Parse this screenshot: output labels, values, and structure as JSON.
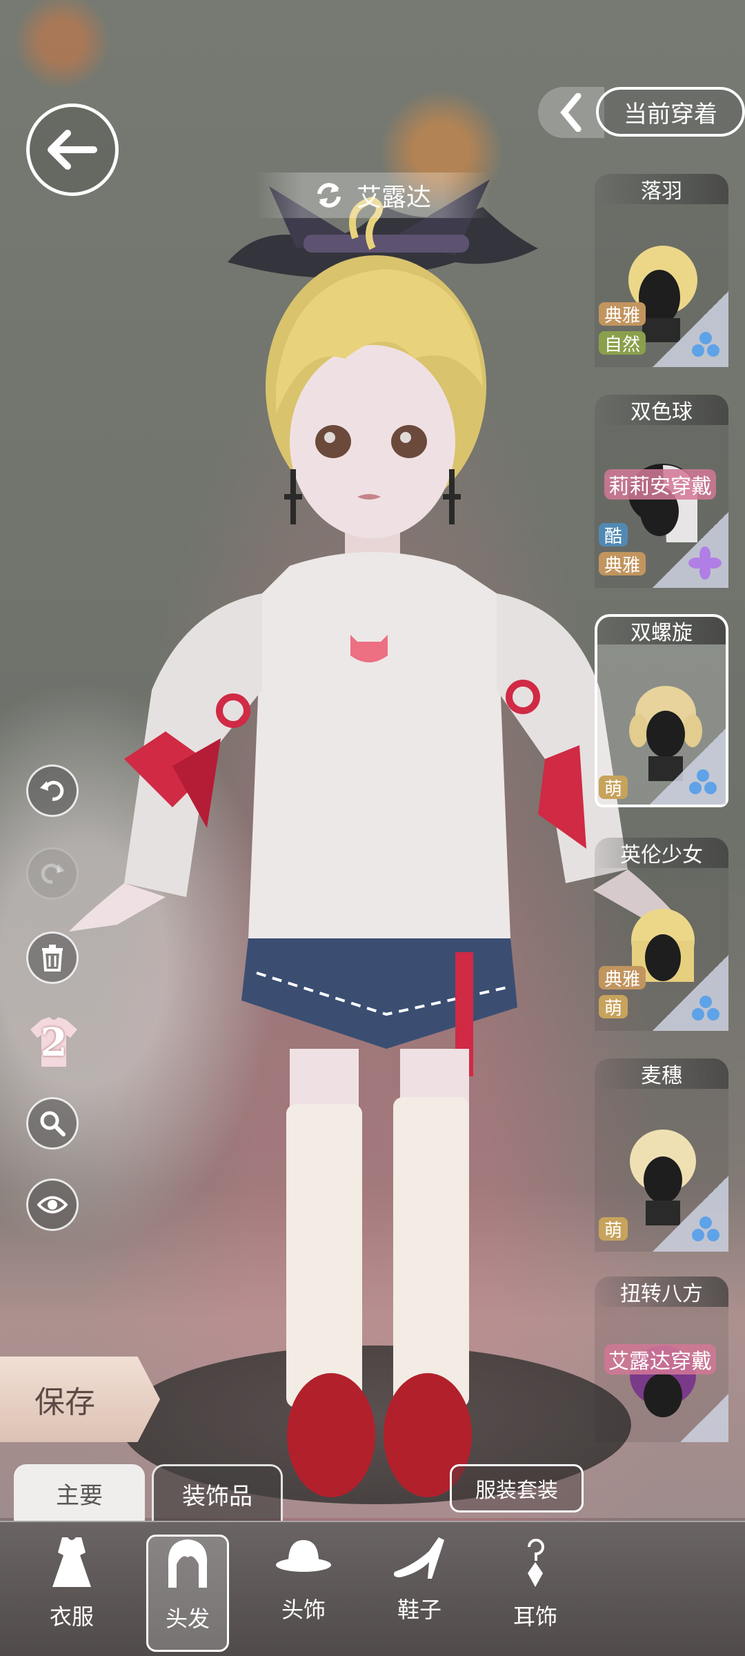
{
  "header": {
    "character_name": "艾露达",
    "current_outfit_label": "当前穿着"
  },
  "hair_list": [
    {
      "name": "落羽",
      "tags": [
        "典雅",
        "自然"
      ],
      "rarity": "blue",
      "selected": false,
      "wearing": ""
    },
    {
      "name": "双色球",
      "tags": [
        "酷",
        "典雅"
      ],
      "rarity": "purple",
      "selected": false,
      "wearing": "莉莉安穿戴"
    },
    {
      "name": "双螺旋",
      "tags": [
        "萌"
      ],
      "rarity": "blue",
      "selected": true,
      "wearing": ""
    },
    {
      "name": "英伦少女",
      "tags": [
        "典雅",
        "萌"
      ],
      "rarity": "blue",
      "selected": false,
      "wearing": ""
    },
    {
      "name": "麦穗",
      "tags": [
        "萌"
      ],
      "rarity": "blue",
      "selected": false,
      "wearing": ""
    },
    {
      "name": "扭转八方",
      "tags": [],
      "rarity": "gold",
      "selected": false,
      "wearing": "艾露达穿戴"
    }
  ],
  "tools": {
    "outfit_count": "2"
  },
  "actions": {
    "save_label": "保存",
    "suit_label": "服装套装"
  },
  "tabs": [
    {
      "label": "主要",
      "active": true
    },
    {
      "label": "装饰品",
      "active": false
    }
  ],
  "categories": [
    {
      "label": "衣服",
      "icon": "dress-icon",
      "selected": false
    },
    {
      "label": "头发",
      "icon": "hair-icon",
      "selected": true
    },
    {
      "label": "头饰",
      "icon": "hat-icon",
      "selected": false
    },
    {
      "label": "鞋子",
      "icon": "shoe-icon",
      "selected": false
    },
    {
      "label": "耳饰",
      "icon": "earring-icon",
      "selected": false
    }
  ],
  "colors": {
    "tag_elegant": "#c2955f",
    "tag_natural": "#8aa04c",
    "tag_cool": "#5189b4",
    "tag_cute": "#c7a35c",
    "wearing_badge": "#d27896"
  }
}
